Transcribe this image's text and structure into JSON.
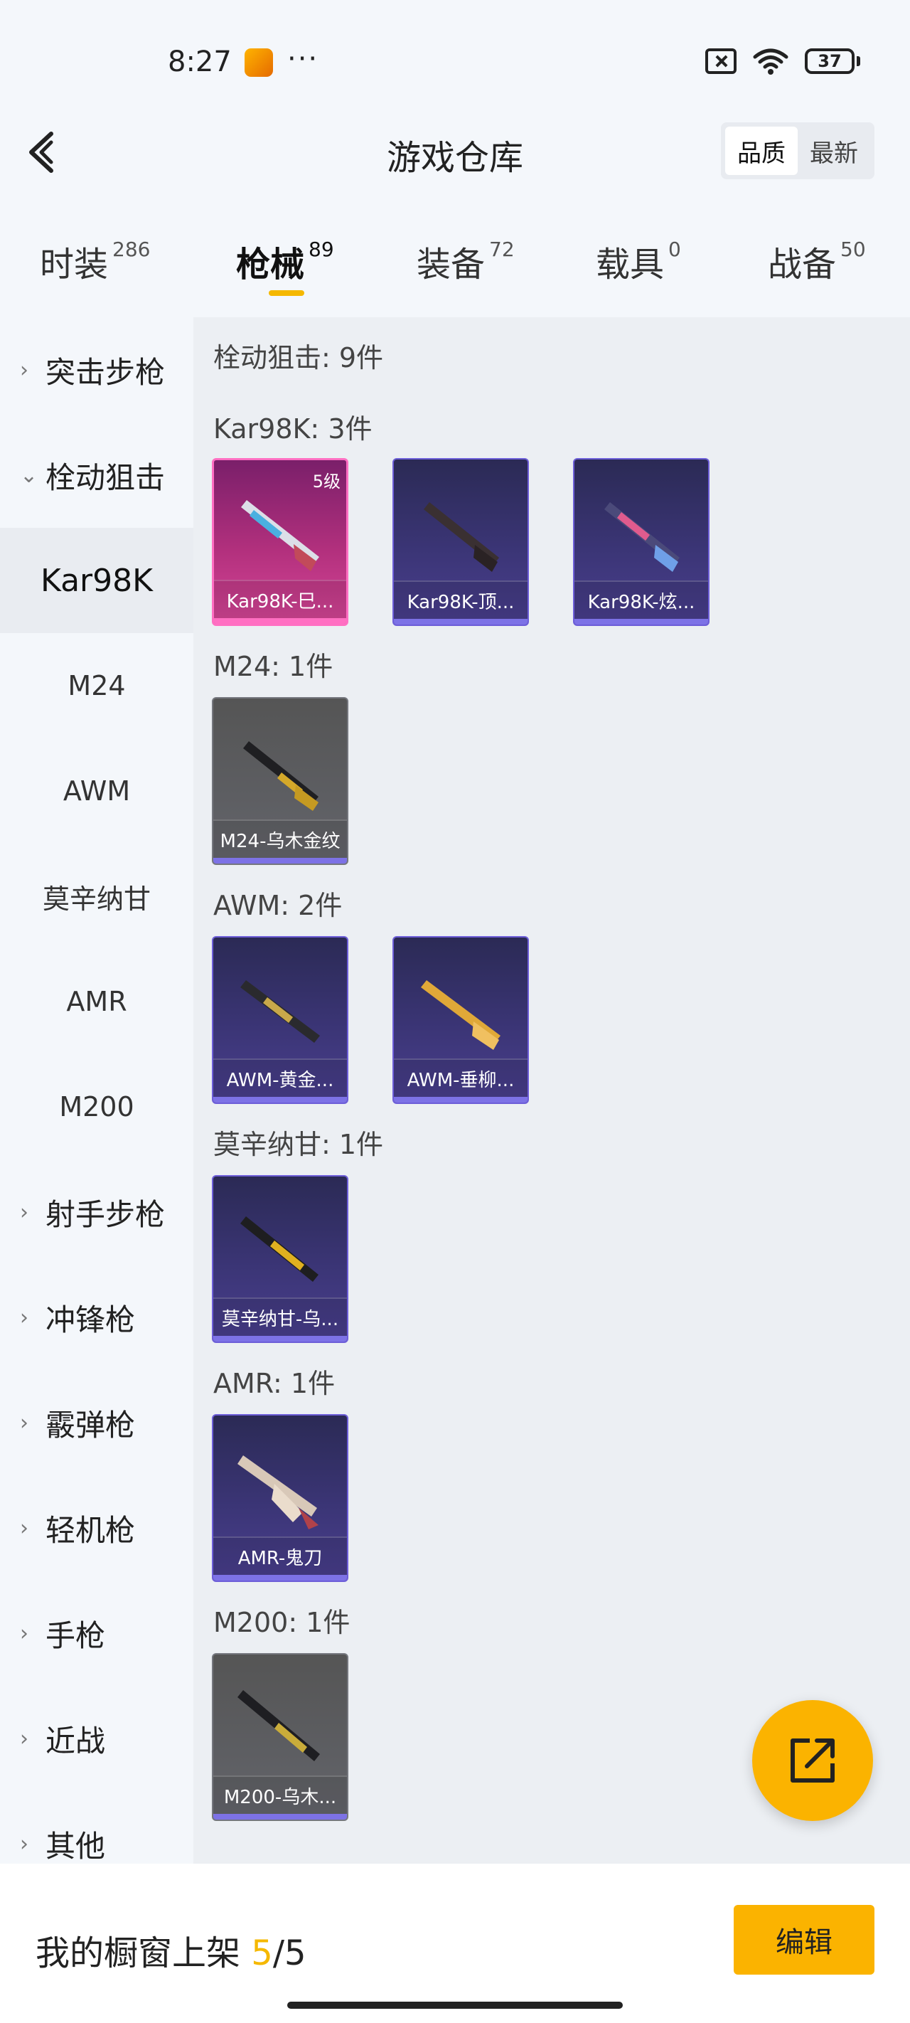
{
  "status_bar": {
    "time": "8:27",
    "battery": "37"
  },
  "header": {
    "title": "游戏仓库",
    "sort_options": [
      "品质",
      "最新"
    ],
    "active_sort": "品质"
  },
  "tabs": [
    {
      "label": "时装",
      "count": "286"
    },
    {
      "label": "枪械",
      "count": "89",
      "active": true
    },
    {
      "label": "装备",
      "count": "72"
    },
    {
      "label": "载具",
      "count": "0"
    },
    {
      "label": "战备",
      "count": "50"
    }
  ],
  "sidebar": {
    "items": [
      {
        "label": "突击步枪",
        "type": "category",
        "chevron": "›"
      },
      {
        "label": "栓动狙击",
        "type": "category",
        "chevron": "⌄"
      },
      {
        "label": "Kar98K",
        "type": "sub",
        "active": true
      },
      {
        "label": "M24",
        "type": "sub"
      },
      {
        "label": "AWM",
        "type": "sub"
      },
      {
        "label": "莫辛纳甘",
        "type": "sub"
      },
      {
        "label": "AMR",
        "type": "sub"
      },
      {
        "label": "M200",
        "type": "sub"
      },
      {
        "label": "射手步枪",
        "type": "category",
        "chevron": "›"
      },
      {
        "label": "冲锋枪",
        "type": "category",
        "chevron": "›"
      },
      {
        "label": "霰弹枪",
        "type": "category",
        "chevron": "›"
      },
      {
        "label": "轻机枪",
        "type": "category",
        "chevron": "›"
      },
      {
        "label": "手枪",
        "type": "category",
        "chevron": "›"
      },
      {
        "label": "近战",
        "type": "category",
        "chevron": "›"
      },
      {
        "label": "其他",
        "type": "category",
        "chevron": "›"
      }
    ]
  },
  "main": {
    "summary": "栓动狙击: 9件",
    "groups": [
      {
        "title": "Kar98K: 3件",
        "items": [
          {
            "name": "Kar98K-巳...",
            "rarity": "pink",
            "badge": "5级"
          },
          {
            "name": "Kar98K-顶...",
            "rarity": "purple"
          },
          {
            "name": "Kar98K-炫...",
            "rarity": "purple"
          }
        ]
      },
      {
        "title": "M24: 1件",
        "items": [
          {
            "name": "M24-乌木金纹",
            "rarity": "gray"
          }
        ]
      },
      {
        "title": "AWM: 2件",
        "items": [
          {
            "name": "AWM-黄金...",
            "rarity": "purple"
          },
          {
            "name": "AWM-垂柳...",
            "rarity": "purple"
          }
        ]
      },
      {
        "title": "莫辛纳甘: 1件",
        "items": [
          {
            "name": "莫辛纳甘-乌...",
            "rarity": "purple"
          }
        ]
      },
      {
        "title": "AMR: 1件",
        "items": [
          {
            "name": "AMR-鬼刀",
            "rarity": "purple"
          }
        ]
      },
      {
        "title": "M200: 1件",
        "items": [
          {
            "name": "M200-乌木...",
            "rarity": "gray"
          }
        ]
      }
    ]
  },
  "bottom_bar": {
    "label": "我的橱窗上架",
    "current": "5",
    "total": "/5",
    "edit_label": "编辑"
  },
  "icons": {
    "back": "back-arrow-icon",
    "share": "share-external-icon"
  },
  "colors": {
    "accent": "#fbb300",
    "purple_rarity": "#6d5ed8",
    "pink_rarity": "#ff6fc2"
  }
}
